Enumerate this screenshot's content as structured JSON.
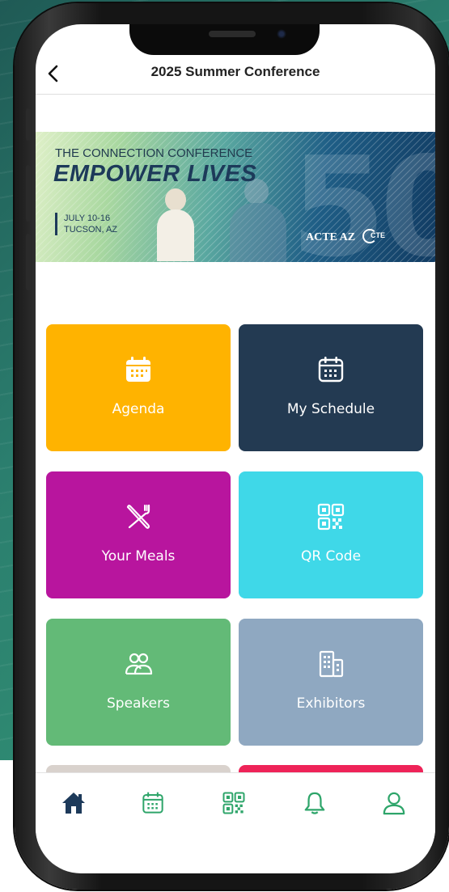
{
  "colors": {
    "agenda": "#ffb300",
    "my_schedule": "#233a52",
    "your_meals": "#b8159e",
    "qr_code": "#3fd8e8",
    "speakers": "#63ba77",
    "exhibitors": "#8fa8c1",
    "partial_left": "#d9d2cd",
    "partial_right": "#ee2358",
    "tab_active": "#1d3a5a",
    "tab_inactive": "#2ea56a"
  },
  "header": {
    "title": "2025 Summer Conference",
    "back_icon": "chevron-left-icon"
  },
  "banner": {
    "supertitle": "THE CONNECTION CONFERENCE",
    "title": "EMPOWER LIVES",
    "dates": "JULY 10-16",
    "location": "TUCSON, AZ",
    "big_number": "50",
    "logo_acte": "ACTE AZ",
    "logo_cte": "CTE"
  },
  "tiles": [
    {
      "label": "Agenda",
      "icon": "calendar-icon"
    },
    {
      "label": "My Schedule",
      "icon": "calendar-icon"
    },
    {
      "label": "Your Meals",
      "icon": "fork-knife-icon"
    },
    {
      "label": "QR Code",
      "icon": "qr-code-icon"
    },
    {
      "label": "Speakers",
      "icon": "people-icon"
    },
    {
      "label": "Exhibitors",
      "icon": "building-icon"
    }
  ],
  "tabbar": [
    {
      "icon": "home-icon",
      "active": true
    },
    {
      "icon": "calendar-icon",
      "active": false
    },
    {
      "icon": "qr-code-icon",
      "active": false
    },
    {
      "icon": "bell-icon",
      "active": false
    },
    {
      "icon": "user-icon",
      "active": false
    }
  ]
}
